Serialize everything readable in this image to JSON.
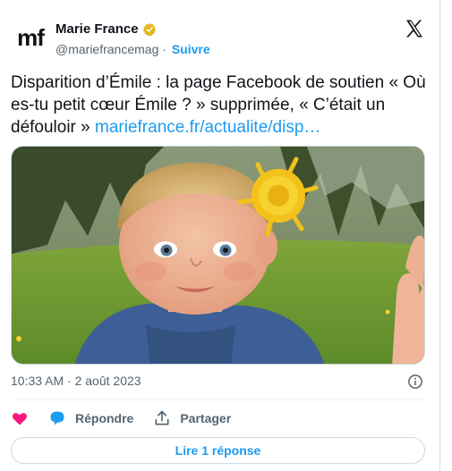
{
  "author": {
    "logo_text": "mf",
    "name": "Marie France",
    "handle": "@mariefrancemag",
    "separator": "·",
    "follow_label": "Suivre"
  },
  "tweet": {
    "text": "Disparition d’Émile : la page Facebook de soutien « Où es-tu petit cœur Émile ? » supprimée, « C’était un défouloir » ",
    "link_text": "mariefrance.fr/actualite/disp…",
    "timestamp": "10:33 AM · 2 août 2023"
  },
  "actions": {
    "reply_label": "Répondre",
    "share_label": "Partager"
  },
  "read_replies_label": "Lire 1 réponse",
  "icons": {
    "verified": "verified-badge-icon",
    "brand": "x-logo-icon",
    "info": "info-icon",
    "like": "heart-icon",
    "reply": "speech-bubble-icon",
    "share": "share-arrow-icon"
  },
  "colors": {
    "accent": "#1d9bf0",
    "verified_gold": "#e2b719",
    "like_pink": "#f91880",
    "muted_text": "#536471"
  }
}
